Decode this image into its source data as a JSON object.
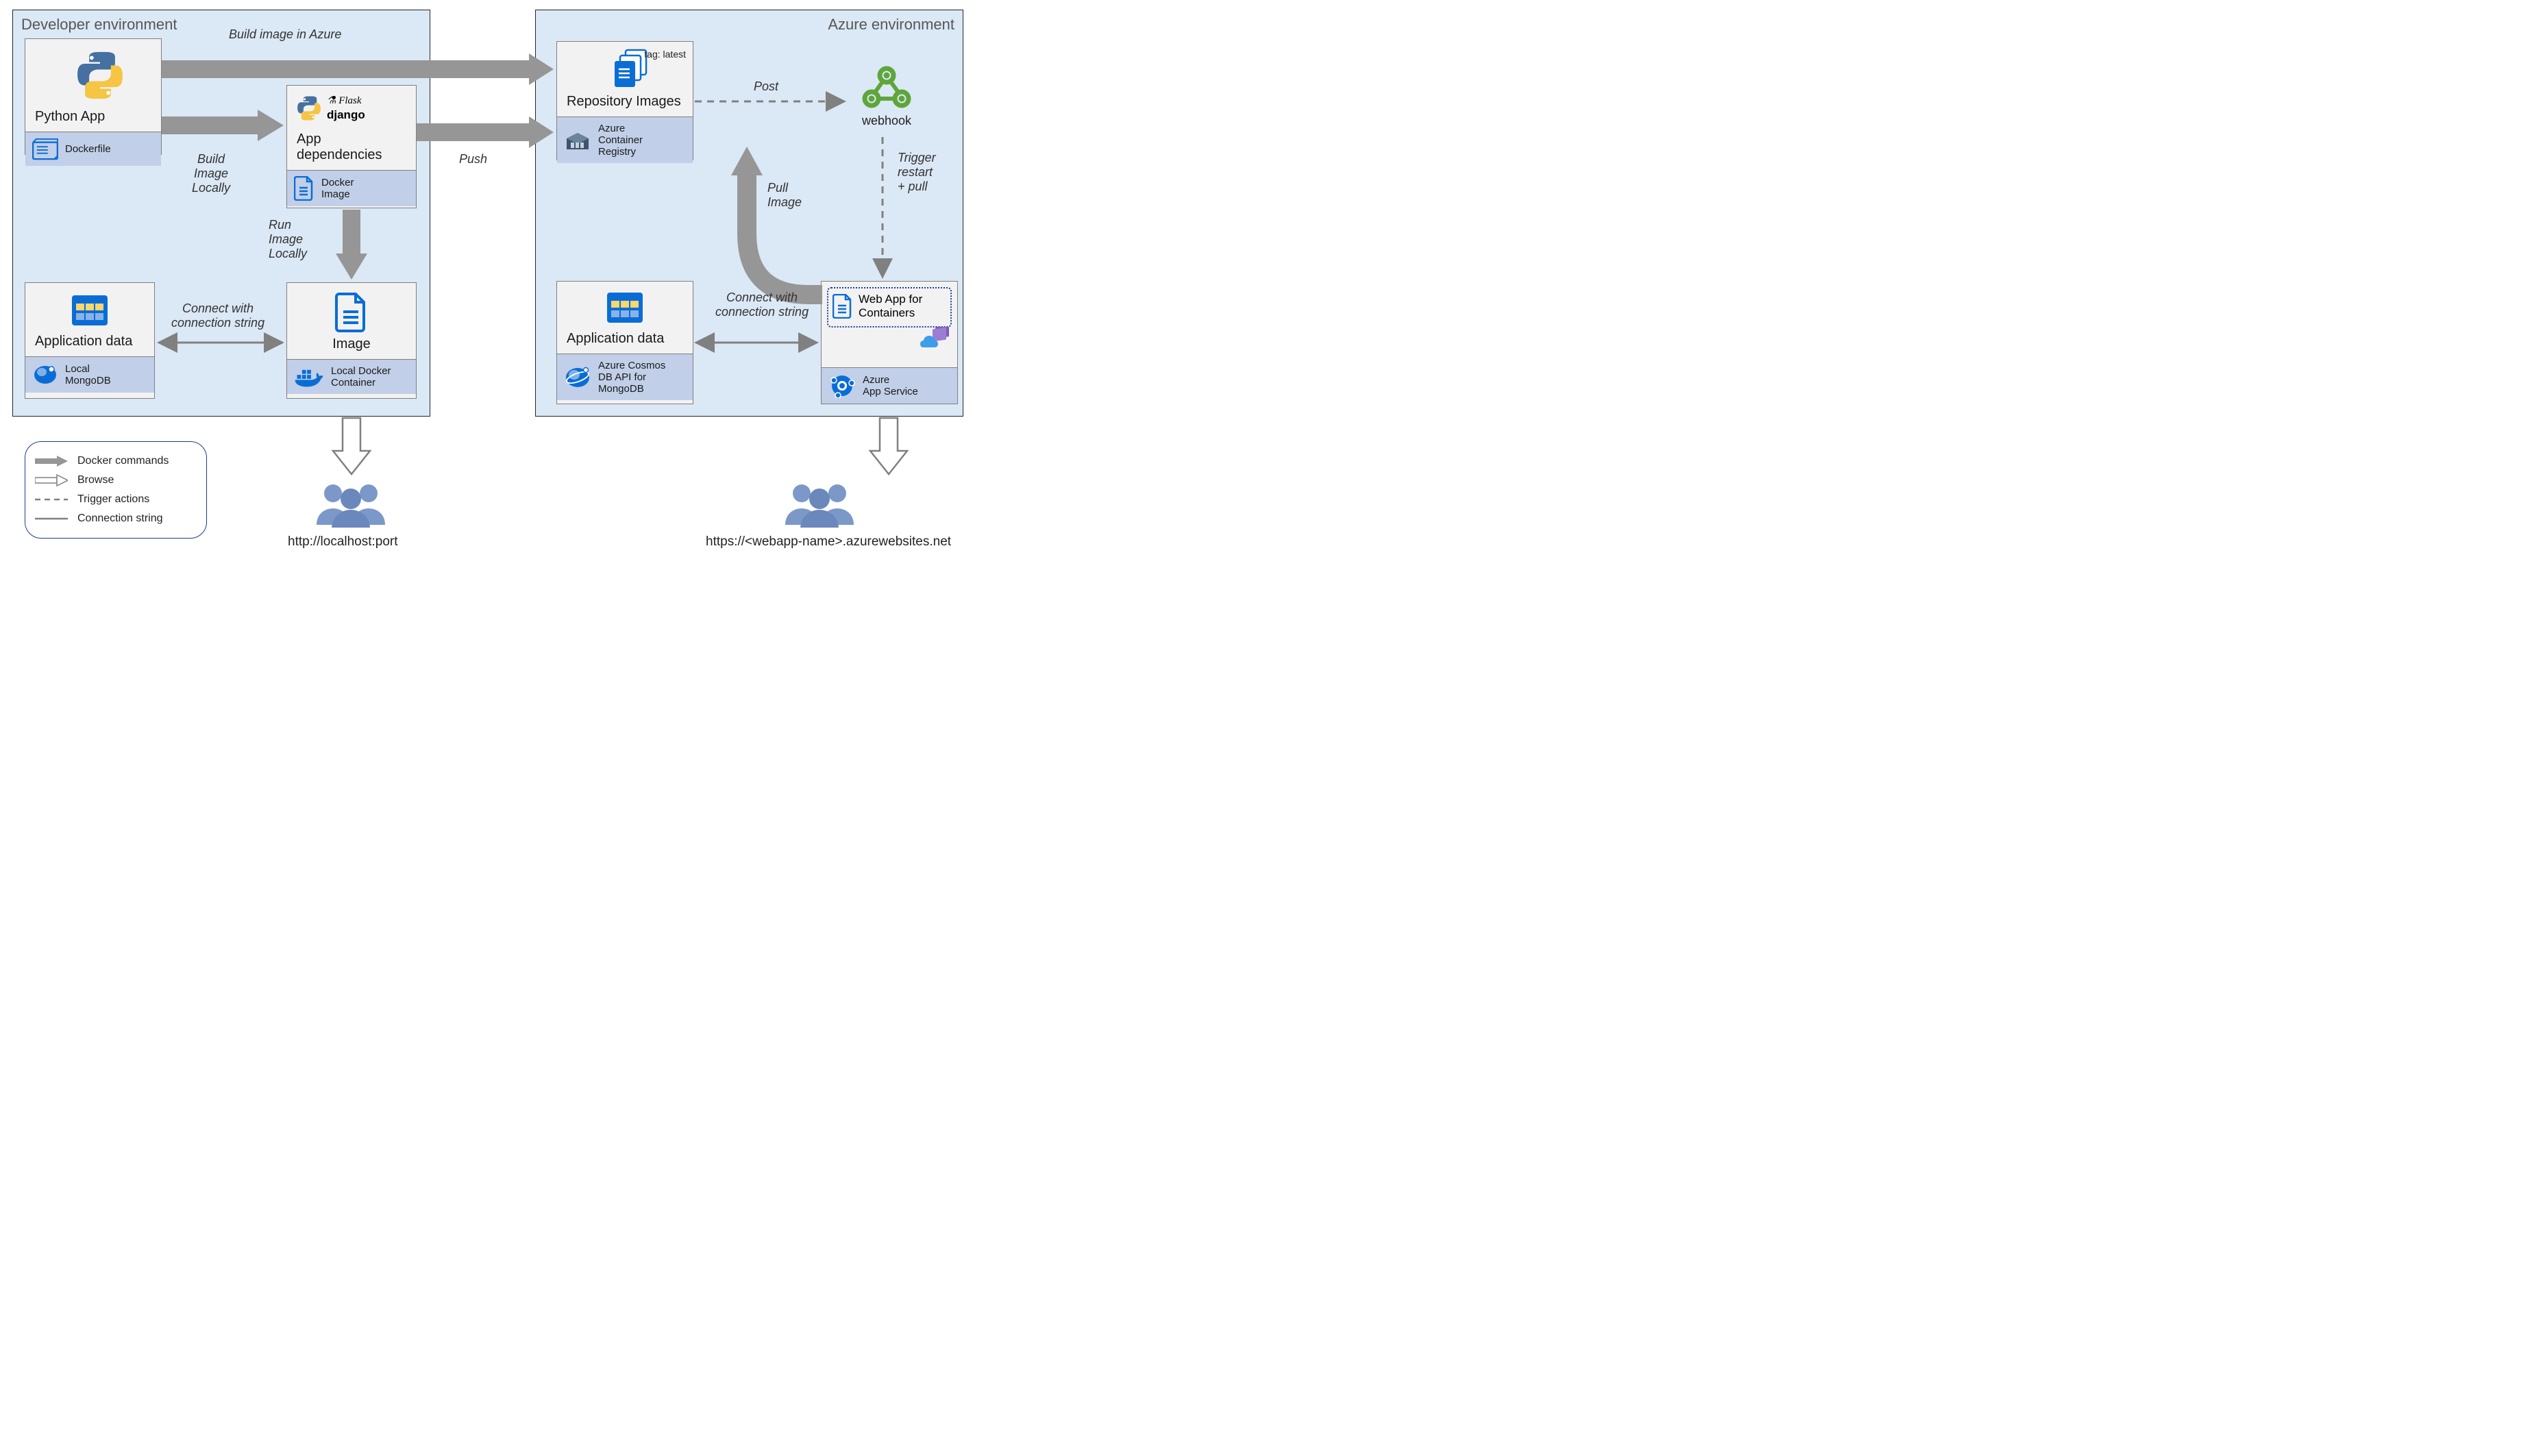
{
  "dev_env": {
    "title": "Developer environment"
  },
  "azure_env": {
    "title": "Azure environment"
  },
  "python_app": {
    "title": "Python App",
    "sub": "Dockerfile"
  },
  "app_deps": {
    "title": "App dependencies",
    "sub": "Docker\nImage"
  },
  "app_data_local": {
    "title": "Application data",
    "sub": "Local\nMongoDB"
  },
  "image_card": {
    "title": "Image",
    "sub": "Local Docker\nContainer"
  },
  "repo_images": {
    "title": "Repository Images",
    "sub": "Azure\nContainer\nRegistry",
    "tag": "tag: latest"
  },
  "webhook": {
    "label": "webhook"
  },
  "app_data_azure": {
    "title": "Application data",
    "sub": "Azure Cosmos\nDB API for\nMongoDB"
  },
  "webapp": {
    "inset_title": "Web App for\nContainers",
    "sub": "Azure\nApp Service"
  },
  "labels": {
    "build_azure": "Build image in Azure",
    "build_local": "Build\nImage\nLocally",
    "run_local": "Run\nImage\nLocally",
    "push": "Push",
    "post": "Post",
    "trigger": "Trigger\nrestart\n+ pull",
    "pull": "Pull\nImage",
    "connect_local": "Connect with\nconnection string",
    "connect_azure": "Connect with\nconnection string"
  },
  "urls": {
    "local": "http://localhost:port",
    "azure": "https://<webapp-name>.azurewebsites.net"
  },
  "legend": {
    "docker": "Docker commands",
    "browse": "Browse",
    "trigger": "Trigger actions",
    "conn": "Connection string"
  }
}
